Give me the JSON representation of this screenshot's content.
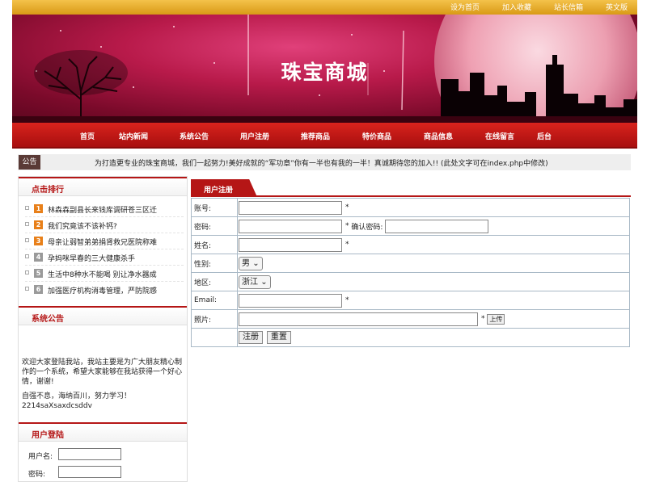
{
  "topbar": {
    "links": [
      "设为首页",
      "加入收藏",
      "站长信箱",
      "英文版"
    ]
  },
  "banner": {
    "title": "珠宝商城"
  },
  "nav": {
    "items": [
      "首页",
      "站内新闻",
      "系统公告",
      "用户注册",
      "推荐商品",
      "特价商品",
      "商品信息",
      "在线留言",
      "后台"
    ]
  },
  "notice": {
    "tag": "公告",
    "text": "为打造更专业的珠宝商城，我们一起努力!美好成就的“军功章”你有一半也有我的一半！真诚期待您的加入!! (此处文字可在index.php中修改)"
  },
  "ranking": {
    "title": "点击排行",
    "items": [
      {
        "num": "1",
        "text": "林森森副县长来钱库调研苍三区迁",
        "color": "#e8801a"
      },
      {
        "num": "2",
        "text": "我们究竟该不该补钙?",
        "color": "#e8801a"
      },
      {
        "num": "3",
        "text": "母亲让弱智弟弟捐肾救兄医院称难",
        "color": "#e8801a"
      },
      {
        "num": "4",
        "text": "孕妈咪早春的三大健康杀手",
        "color": "#9a9a9a"
      },
      {
        "num": "5",
        "text": "生活中8种水不能喝 别让净水器成",
        "color": "#9a9a9a"
      },
      {
        "num": "6",
        "text": "加强医疗机构消毒管理，严防院感",
        "color": "#9a9a9a"
      }
    ]
  },
  "announcement": {
    "title": "系统公告",
    "para1": "欢迎大家登陆我站，我站主要是为广大朋友精心制作的一个系统，希望大家能够在我站获得一个好心情，谢谢!",
    "para2": "自强不息，海纳百川，努力学习！2214saXsaxdcsddv"
  },
  "login": {
    "title": "用户登陆",
    "username_label": "用户名:",
    "password_label": "密码:"
  },
  "register": {
    "title": "用户注册",
    "account_label": "账号:",
    "password_label": "密码:",
    "confirm_label": "确认密码:",
    "name_label": "姓名:",
    "gender_label": "性别:",
    "gender_value": "男",
    "region_label": "地区:",
    "region_value": "浙江",
    "email_label": "Email:",
    "photo_label": "照片:",
    "required_mark": "*",
    "upload_button": "上传",
    "submit_button": "注册",
    "reset_button": "重置"
  },
  "colors": {
    "brand_red": "#b51616",
    "topbar_gold": "#e0a828",
    "notice_tag": "#5a3a36"
  }
}
